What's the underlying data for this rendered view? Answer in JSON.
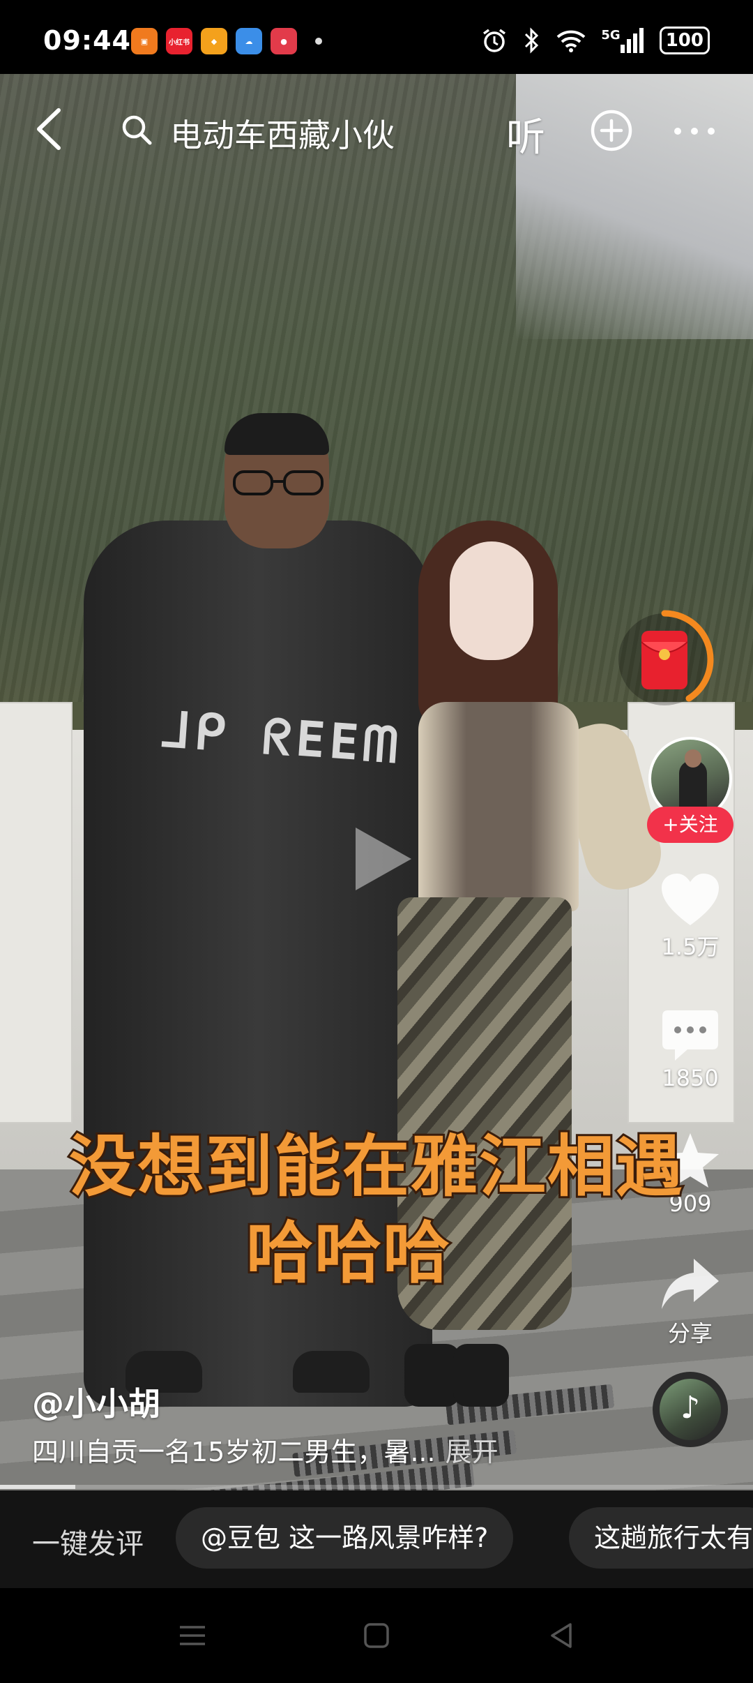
{
  "status_bar": {
    "time": "09:44",
    "apps": [
      {
        "label": "",
        "color": "#f07a1e"
      },
      {
        "label": "小红书",
        "color": "#e8222f"
      },
      {
        "label": "",
        "color": "#f4a11c"
      },
      {
        "label": "",
        "color": "#3b8ee8"
      },
      {
        "label": "",
        "color": "#e23b4a"
      }
    ],
    "network": "5G",
    "battery": "100"
  },
  "top_bar": {
    "search_text": "电动车西藏小伙",
    "listen_label": "听"
  },
  "caption": {
    "line1": "没想到能在雅江相遇",
    "line2": "哈哈哈",
    "color": "#f39a37"
  },
  "actions": {
    "follow_label": "+关注",
    "like_count": "1.5万",
    "comment_count": "1850",
    "favorite_count": "909",
    "share_label": "分享"
  },
  "post": {
    "author": "@小小胡",
    "description": "四川自贡一名15岁初二男生，暑...",
    "expand_label": "展开",
    "progress": 0.1
  },
  "prompt_bar": {
    "label": "一键发评",
    "chips": [
      "@豆包 这一路风景咋样?",
      "这趟旅行太有"
    ]
  },
  "colors": {
    "accent_red": "#f2324a"
  }
}
